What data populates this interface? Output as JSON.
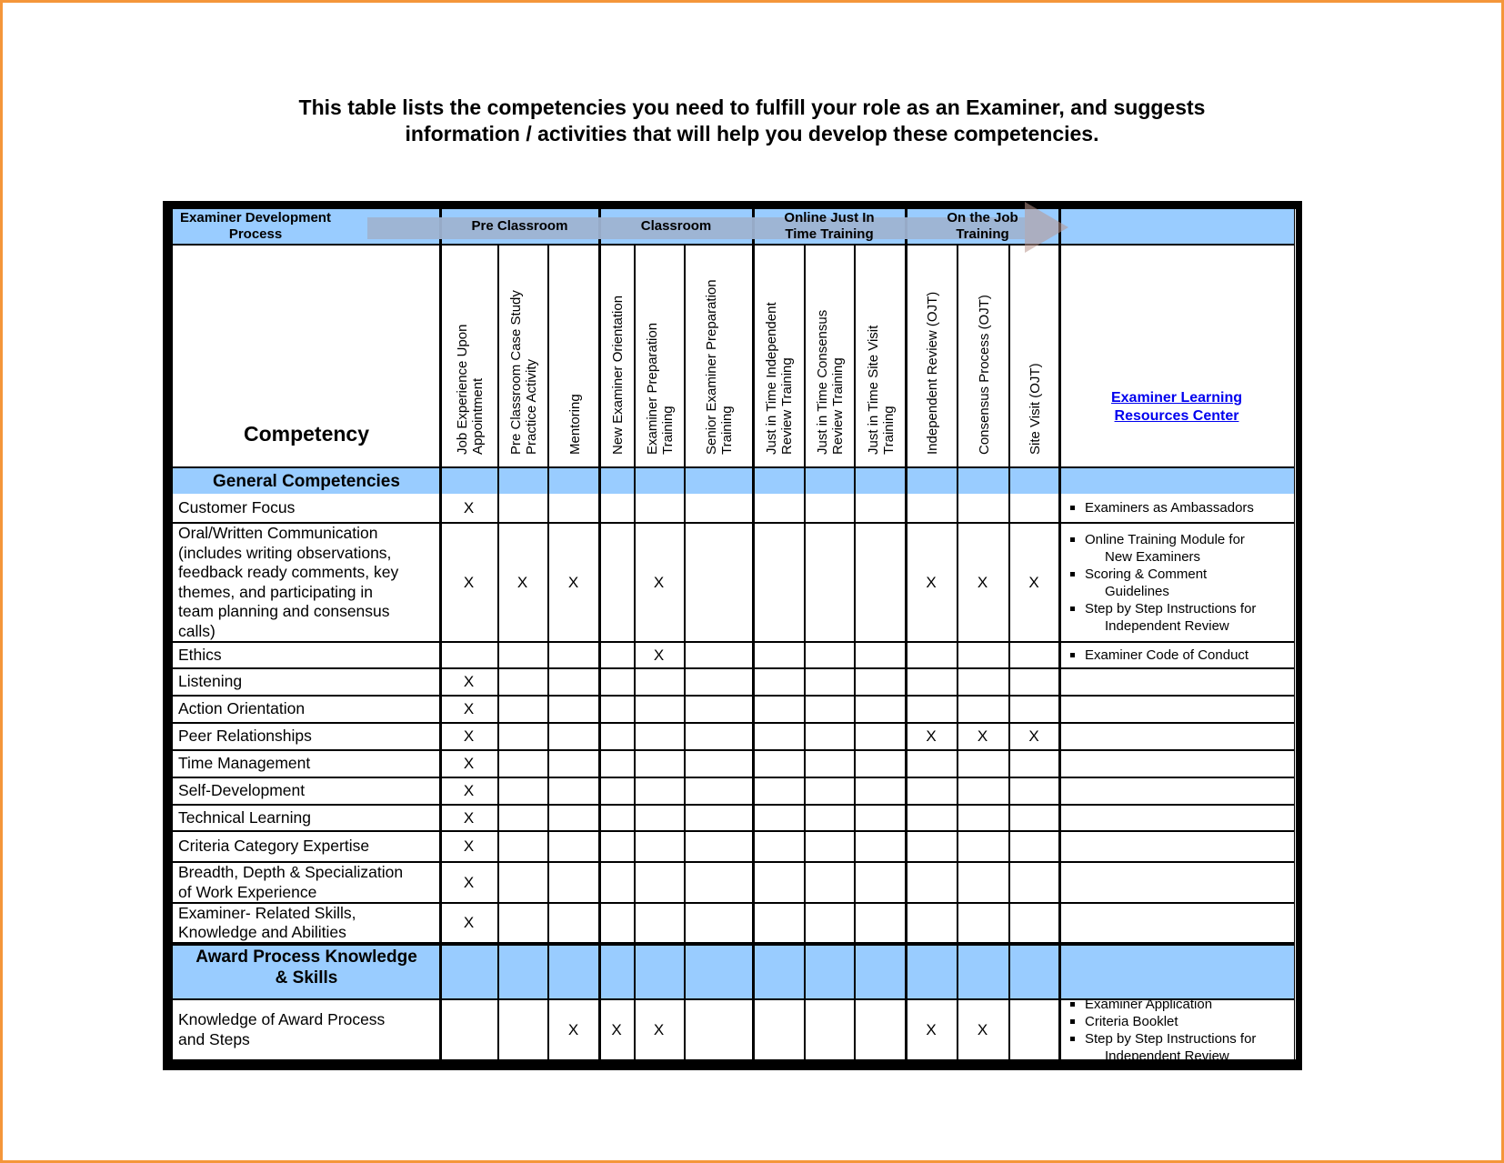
{
  "title": {
    "line1": "This table lists the competencies you need to fulfill your role as an Examiner, and suggests",
    "line2": "information / activities that will help you develop these competencies."
  },
  "header": {
    "process_label_line1": "Examiner Development",
    "process_label_line2": "Process",
    "phases": [
      {
        "line1": "Pre Classroom",
        "line2": ""
      },
      {
        "line1": "Classroom",
        "line2": ""
      },
      {
        "line1": "Online Just In",
        "line2": "Time Training"
      },
      {
        "line1": "On the Job",
        "line2": "Training"
      }
    ],
    "competency_label": "Competency",
    "activities": [
      {
        "line1": "Job Experience Upon",
        "line2": "Appointment"
      },
      {
        "line1": "Pre Classroom Case Study",
        "line2": "Practice Activity"
      },
      {
        "line1": "Mentoring",
        "line2": ""
      },
      {
        "line1": "New Examiner Orientation",
        "line2": ""
      },
      {
        "line1": "Examiner Preparation",
        "line2": "Training"
      },
      {
        "line1": "Senior Examiner Preparation",
        "line2": "Training"
      },
      {
        "line1": "Just in Time Independent",
        "line2": "Review  Training"
      },
      {
        "line1": "Just in Time Consensus",
        "line2": "Review  Training"
      },
      {
        "line1": "Just in Time Site Visit",
        "line2": "Training"
      },
      {
        "line1": "Independent Review  (OJT)",
        "line2": ""
      },
      {
        "line1": "Consensus Process (OJT)",
        "line2": ""
      },
      {
        "line1": "Site Visit (OJT)",
        "line2": ""
      }
    ],
    "resources_link_line1": "Examiner Learning",
    "resources_link_line2": "Resources Center"
  },
  "mark_symbol": "X",
  "sections": [
    {
      "title_line1": "General Competencies",
      "title_line2": "",
      "rows": [
        {
          "lines": [
            "Customer Focus"
          ],
          "marks": [
            1,
            0,
            0,
            0,
            0,
            0,
            0,
            0,
            0,
            0,
            0,
            0
          ],
          "resources": [
            [
              "Examiners as Ambassadors"
            ]
          ]
        },
        {
          "lines": [
            "Oral/Written Communication",
            "(includes writing observations,",
            "feedback ready comments, key",
            "themes, and participating in",
            "team planning and consensus",
            "calls)"
          ],
          "marks": [
            1,
            1,
            1,
            0,
            1,
            0,
            0,
            0,
            0,
            1,
            1,
            1
          ],
          "resources": [
            [
              "Online Training Module for",
              "New Examiners"
            ],
            [
              "Scoring & Comment",
              "Guidelines"
            ],
            [
              "Step by Step Instructions for",
              "Independent Review"
            ]
          ]
        },
        {
          "lines": [
            "Ethics"
          ],
          "marks": [
            0,
            0,
            0,
            0,
            1,
            0,
            0,
            0,
            0,
            0,
            0,
            0
          ],
          "resources": [
            [
              "Examiner Code of Conduct"
            ]
          ]
        },
        {
          "lines": [
            "Listening"
          ],
          "marks": [
            1,
            0,
            0,
            0,
            0,
            0,
            0,
            0,
            0,
            0,
            0,
            0
          ],
          "resources": []
        },
        {
          "lines": [
            "Action Orientation"
          ],
          "marks": [
            1,
            0,
            0,
            0,
            0,
            0,
            0,
            0,
            0,
            0,
            0,
            0
          ],
          "resources": []
        },
        {
          "lines": [
            "Peer Relationships"
          ],
          "marks": [
            1,
            0,
            0,
            0,
            0,
            0,
            0,
            0,
            0,
            1,
            1,
            1
          ],
          "resources": []
        },
        {
          "lines": [
            "Time Management"
          ],
          "marks": [
            1,
            0,
            0,
            0,
            0,
            0,
            0,
            0,
            0,
            0,
            0,
            0
          ],
          "resources": []
        },
        {
          "lines": [
            "Self-Development"
          ],
          "marks": [
            1,
            0,
            0,
            0,
            0,
            0,
            0,
            0,
            0,
            0,
            0,
            0
          ],
          "resources": []
        },
        {
          "lines": [
            "Technical Learning"
          ],
          "marks": [
            1,
            0,
            0,
            0,
            0,
            0,
            0,
            0,
            0,
            0,
            0,
            0
          ],
          "resources": []
        },
        {
          "lines": [
            "Criteria Category Expertise"
          ],
          "marks": [
            1,
            0,
            0,
            0,
            0,
            0,
            0,
            0,
            0,
            0,
            0,
            0
          ],
          "resources": []
        },
        {
          "lines": [
            "Breadth, Depth & Specialization",
            "of  Work Experience"
          ],
          "marks": [
            1,
            0,
            0,
            0,
            0,
            0,
            0,
            0,
            0,
            0,
            0,
            0
          ],
          "resources": []
        },
        {
          "lines": [
            "Examiner- Related Skills,",
            "Knowledge and Abilities"
          ],
          "marks": [
            1,
            0,
            0,
            0,
            0,
            0,
            0,
            0,
            0,
            0,
            0,
            0
          ],
          "resources": []
        }
      ]
    },
    {
      "title_line1": "Award Process Knowledge",
      "title_line2": "& Skills",
      "rows": [
        {
          "lines": [
            "Knowledge of  Award Process",
            "and Steps"
          ],
          "marks": [
            0,
            0,
            1,
            1,
            1,
            0,
            0,
            0,
            0,
            1,
            1,
            0
          ],
          "resources": [
            [
              "Examiner Application"
            ],
            [
              "Criteria Booklet"
            ],
            [
              "Step by Step Instructions for",
              "Independent Review"
            ]
          ]
        }
      ]
    }
  ]
}
